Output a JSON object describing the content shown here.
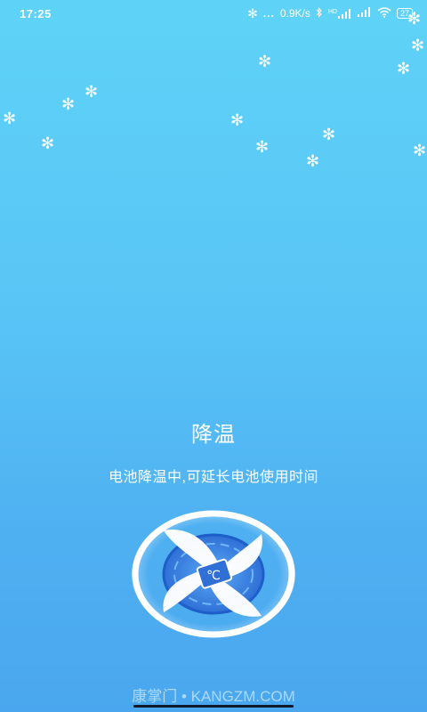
{
  "status_bar": {
    "time": "17:25",
    "dots": "...",
    "speed": "0.9K/s",
    "network_label": "HD",
    "battery": "27"
  },
  "main": {
    "title": "降温",
    "subtitle": "电池降温中,可延长电池使用时间"
  },
  "fan": {
    "center_label": "℃"
  },
  "watermark": "康掌门 • KANGZM.COM",
  "snowflake_glyph": "✻",
  "colors": {
    "background_top": "#5fd3f7",
    "background_bottom": "#4aa7ef",
    "fan_ring": "#ffffff",
    "fan_core": "#2f7de1",
    "text": "#ffffff"
  }
}
